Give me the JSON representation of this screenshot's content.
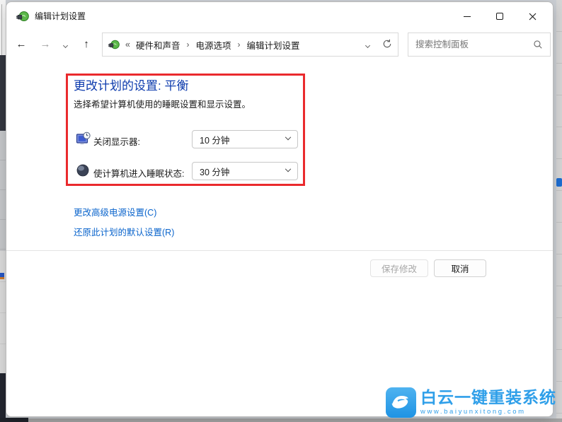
{
  "window": {
    "title": "编辑计划设置"
  },
  "navbar": {
    "glyphs": {
      "back": "←",
      "forward": "→",
      "up": "↑"
    },
    "breadcrumb": {
      "overflow_glyph": "«",
      "separator_glyph": "›",
      "items": [
        "硬件和声音",
        "电源选项",
        "编辑计划设置"
      ]
    },
    "search": {
      "placeholder": "搜索控制面板"
    }
  },
  "content": {
    "heading": "更改计划的设置: 平衡",
    "description": "选择希望计算机使用的睡眠设置和显示设置。",
    "settings": [
      {
        "icon": "display-timeout-icon",
        "label": "关闭显示器:",
        "value": "10 分钟"
      },
      {
        "icon": "sleep-icon",
        "label": "使计算机进入睡眠状态:",
        "value": "30 分钟"
      }
    ],
    "links": [
      {
        "label": "更改高级电源设置(C)"
      },
      {
        "label": "还原此计划的默认设置(R)"
      }
    ]
  },
  "footer": {
    "save_label": "保存修改",
    "save_enabled": false,
    "cancel_label": "取消"
  },
  "watermark": {
    "name": "白云一键重装系统",
    "url": "www.baiyunxitong.com"
  },
  "icons": {
    "app": "power-plan-icon",
    "address": "power-plan-icon",
    "refresh": "refresh-icon",
    "search": "magnifier-icon",
    "row1": "display-timeout-icon",
    "row2": "sleep-icon",
    "watermark": "bird-logo-icon"
  },
  "colors": {
    "heading_blue": "#0d3bad",
    "link_blue": "#0a64cc",
    "highlight_red": "#ea2a2d",
    "watermark_blue": "#2f9fe9"
  }
}
